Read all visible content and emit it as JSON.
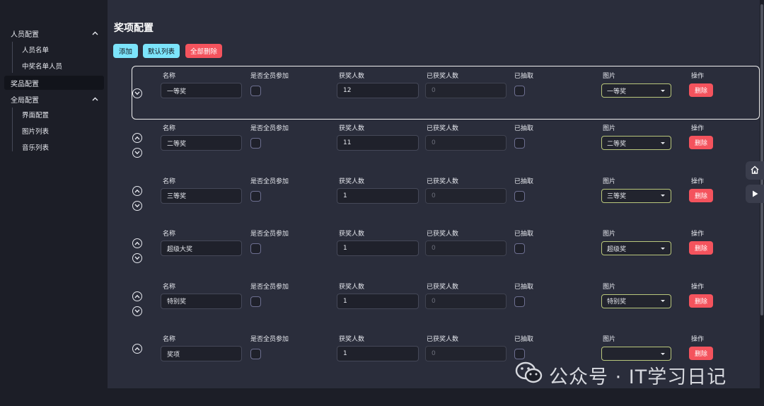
{
  "sidebar": {
    "groups": [
      {
        "label": "人员配置",
        "items": [
          "人员名单",
          "中奖名单人员"
        ]
      },
      {
        "label": "奖品配置",
        "active": true
      },
      {
        "label": "全局配置",
        "items": [
          "界面配置",
          "图片列表",
          "音乐列表"
        ]
      }
    ]
  },
  "page": {
    "title": "奖项配置"
  },
  "toolbar": {
    "add": "添加",
    "default_list": "默认列表",
    "delete_all": "全部删除"
  },
  "columns": {
    "name": "名称",
    "all_join": "是否全员参加",
    "winner_count": "获奖人数",
    "already_won": "已获奖人数",
    "drawn": "已抽取",
    "image": "图片",
    "actions": "操作"
  },
  "delete_label": "删除",
  "prizes": [
    {
      "name": "一等奖",
      "count": "12",
      "won": "0",
      "image": "一等奖"
    },
    {
      "name": "二等奖",
      "count": "11",
      "won": "0",
      "image": "二等奖"
    },
    {
      "name": "三等奖",
      "count": "1",
      "won": "0",
      "image": "三等奖"
    },
    {
      "name": "超级大奖",
      "count": "1",
      "won": "0",
      "image": "超级奖"
    },
    {
      "name": "特别奖",
      "count": "1",
      "won": "0",
      "image": "特别奖"
    },
    {
      "name": "奖项",
      "count": "1",
      "won": "0",
      "image": ""
    }
  ],
  "watermark": "公众号 · IT学习日记",
  "colors": {
    "accent": "#7ce4fb",
    "danger": "#f4535d",
    "select_border": "#b9c77c"
  }
}
